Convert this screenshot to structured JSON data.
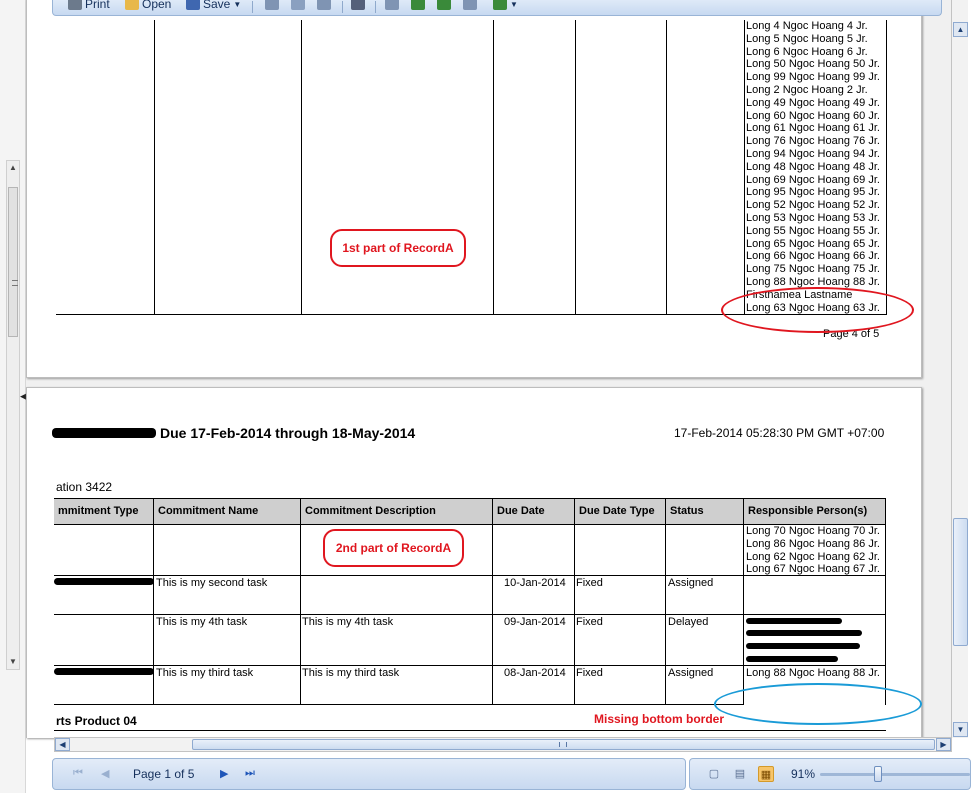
{
  "toolbar": {
    "print_label": "Print",
    "open_label": "Open",
    "save_label": "Save"
  },
  "page4": {
    "names": [
      "Long 4 Ngoc Hoang 4 Jr.",
      "Long 5 Ngoc Hoang 5 Jr.",
      "Long 6 Ngoc Hoang 6 Jr.",
      "Long 50 Ngoc Hoang 50 Jr.",
      "Long 99 Ngoc Hoang 99 Jr.",
      "Long 2 Ngoc Hoang 2 Jr.",
      "Long 49 Ngoc Hoang 49 Jr.",
      "Long 60 Ngoc Hoang 60 Jr.",
      "Long 61 Ngoc Hoang 61 Jr.",
      "Long 76 Ngoc Hoang 76 Jr.",
      "Long 94 Ngoc Hoang 94 Jr.",
      "Long 48 Ngoc Hoang 48 Jr.",
      "Long 69 Ngoc Hoang 69 Jr.",
      "Long 95 Ngoc Hoang 95 Jr.",
      "Long 52 Ngoc Hoang 52 Jr.",
      "Long 53 Ngoc Hoang 53 Jr.",
      "Long 55 Ngoc Hoang 55 Jr.",
      "Long 65 Ngoc Hoang 65 Jr.",
      "Long 66 Ngoc Hoang 66 Jr.",
      "Long 75 Ngoc Hoang 75 Jr.",
      "Long 88 Ngoc Hoang 88 Jr.",
      "Firstnamea Lastname",
      "Long 63 Ngoc Hoang 63 Jr."
    ],
    "callout": "1st part of RecordA",
    "page_number": "Page 4 of 5"
  },
  "page5": {
    "title": "Due 17-Feb-2014 through 18-May-2014",
    "timestamp": "17-Feb-2014 05:28:30 PM GMT +07:00",
    "location": "ation 3422",
    "headers": [
      "mmitment Type",
      "Commitment Name",
      "Commitment Description",
      "Due Date",
      "Due Date Type",
      "Status",
      "Responsible Person(s)"
    ],
    "callout": "2nd part of RecordA",
    "rowA_names": [
      "Long 70 Ngoc Hoang 70 Jr.",
      "Long 86 Ngoc Hoang 86 Jr.",
      "Long 62 Ngoc Hoang 62 Jr.",
      "Long 67 Ngoc Hoang 67 Jr."
    ],
    "rows": [
      {
        "name": "This is my second task",
        "desc": "",
        "due": "10-Jan-2014",
        "type": "Fixed",
        "status": "Assigned"
      },
      {
        "name": "This is my 4th task",
        "desc": "This is my 4th task",
        "due": "09-Jan-2014",
        "type": "Fixed",
        "status": "Delayed"
      },
      {
        "name": "This is my third task",
        "desc": "This is my third task",
        "due": "08-Jan-2014",
        "type": "Fixed",
        "status": "Assigned",
        "person": "Long 88 Ngoc Hoang 88 Jr."
      }
    ],
    "group_label": "rts Product 04",
    "missing_border_note": "Missing bottom border"
  },
  "nav": {
    "page_indicator": "Page 1 of 5",
    "zoom": "91%"
  },
  "colors": {
    "annotation_red": "#e0161f",
    "annotation_blue": "#1a9bd7",
    "header_gray": "#cfcfcf"
  }
}
